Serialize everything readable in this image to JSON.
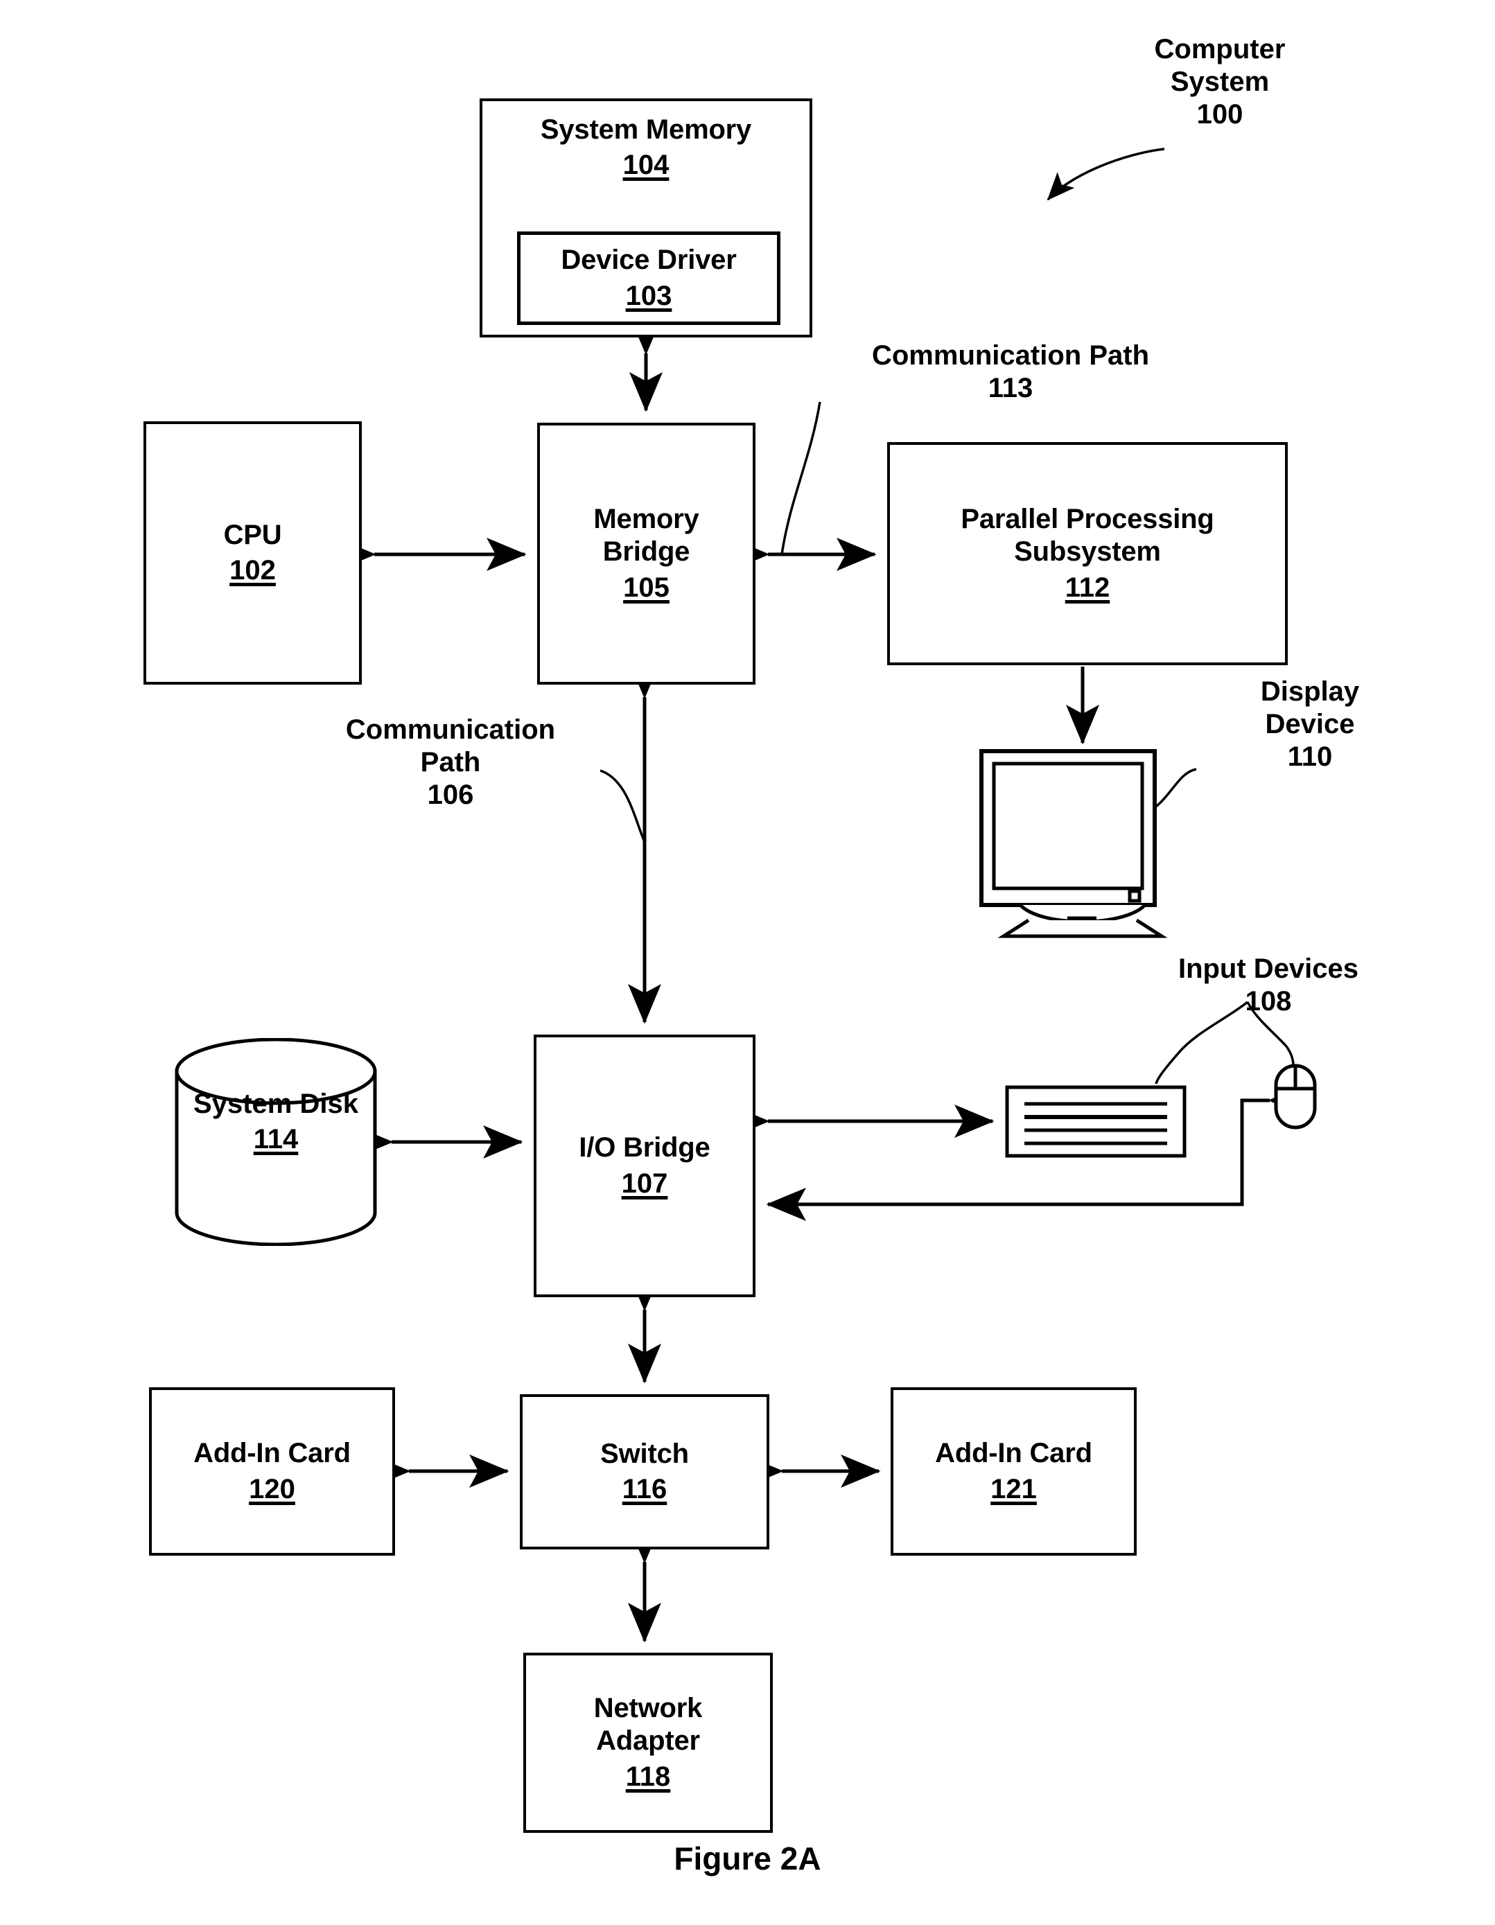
{
  "figure": {
    "caption": "Figure 2A"
  },
  "annotations": {
    "computer_system": "Computer\nSystem\n100",
    "communication_path_113": "Communication Path\n113",
    "communication_path_106": "Communication\nPath\n106",
    "display_device": "Display\nDevice\n110",
    "input_devices": "Input Devices\n108"
  },
  "nodes": {
    "system_memory": {
      "title": "System Memory",
      "number": "104"
    },
    "device_driver": {
      "title": "Device Driver",
      "number": "103"
    },
    "cpu": {
      "title": "CPU",
      "number": "102"
    },
    "memory_bridge": {
      "title": "Memory\nBridge",
      "number": "105"
    },
    "parallel_processing_subsystem": {
      "title": "Parallel Processing\nSubsystem",
      "number": "112"
    },
    "system_disk": {
      "title": "System\nDisk",
      "number": "114"
    },
    "io_bridge": {
      "title": "I/O Bridge",
      "number": "107"
    },
    "switch": {
      "title": "Switch",
      "number": "116"
    },
    "add_in_card_120": {
      "title": "Add-In Card",
      "number": "120"
    },
    "add_in_card_121": {
      "title": "Add-In Card",
      "number": "121"
    },
    "network_adapter": {
      "title": "Network\nAdapter",
      "number": "118"
    }
  },
  "icons": {
    "display_device": "monitor-icon",
    "keyboard": "keyboard-icon",
    "mouse": "mouse-icon",
    "system_disk": "cylinder-database-icon"
  },
  "colors": {
    "ink": "#000000",
    "paper": "#ffffff"
  }
}
